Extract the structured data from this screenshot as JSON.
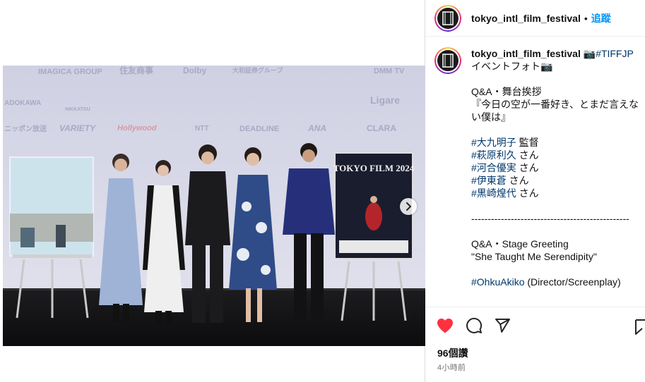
{
  "post": {
    "username": "tokyo_intl_film_festival",
    "separator": "•",
    "follow_label": "追蹤",
    "likes": "96個讚",
    "time_ago": "4小時前"
  },
  "caption": {
    "username": "tokyo_intl_film_festival",
    "camera_emoji": "📷",
    "hashtag_main": "#TIFFJP",
    "intro_text": "イベントフォト📷",
    "line_qa_jp": "Q&A・舞台挨拶",
    "line_title_jp": "『今日の空が一番好き、とまだ言えない僕は』",
    "people": [
      {
        "tag": "#大九明子",
        "role": " 監督"
      },
      {
        "tag": "#萩原利久",
        "role": " さん"
      },
      {
        "tag": "#河合優実",
        "role": " さん"
      },
      {
        "tag": "#伊東蒼",
        "role": " さん"
      },
      {
        "tag": "#黒崎煌代",
        "role": " さん"
      }
    ],
    "dashes": "------------------------------------------------",
    "line_qa_en": "Q&A・Stage Greeting",
    "line_title_en": "\"She Taught Me Serendipity\"",
    "credit_tag": "#OhkuAkiko",
    "credit_role": " (Director/Screenplay)"
  },
  "photo": {
    "sponsor_row1": [
      "IMAGICA GROUP",
      "住友商事",
      "Dolby",
      "大和証券グループ",
      "DMM TV"
    ],
    "sponsor_row2": [
      "ADOKAWA",
      "NIKKATSU",
      "Ligare"
    ],
    "sponsor_row3": [
      "ニッポン放送",
      "VARIETY",
      "Hollywood",
      "NTT",
      "DEADLINE",
      "ANA",
      "CLARA"
    ],
    "poster_title": "TOKYO FILM 2024"
  },
  "colors": {
    "accent": "#0095f6",
    "hashtag": "#00376b",
    "like": "#ff3040",
    "muted": "#737373"
  },
  "icons": {
    "avatar": "film-logo-icon",
    "like": "heart-icon",
    "comment": "comment-icon",
    "share": "send-icon",
    "save": "bookmark-icon",
    "next": "chevron-right-icon"
  }
}
